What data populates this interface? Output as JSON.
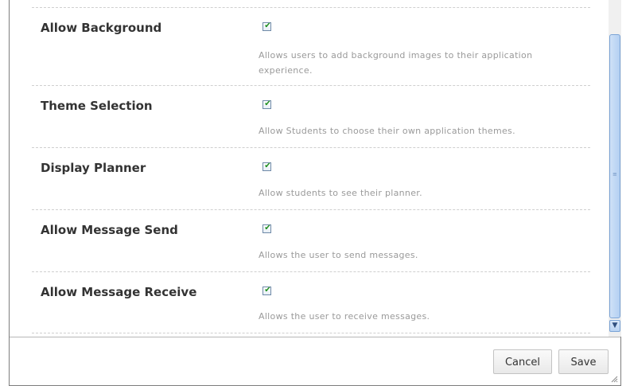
{
  "settings": [
    {
      "label": "Allow Background",
      "checked": true,
      "description": "Allows users to add background images to their application experience."
    },
    {
      "label": "Theme Selection",
      "checked": true,
      "description": "Allow Students to choose their own application themes."
    },
    {
      "label": "Display Planner",
      "checked": true,
      "description": "Allow students to see their planner."
    },
    {
      "label": "Allow Message Send",
      "checked": true,
      "description": "Allows the user to send messages."
    },
    {
      "label": "Allow Message Receive",
      "checked": true,
      "description": "Allows the user to receive messages."
    }
  ],
  "footer": {
    "cancel_label": "Cancel",
    "save_label": "Save"
  },
  "icons": {
    "checkbox_checked": "checkmark-icon",
    "scroll_down": "chevron-down-icon",
    "resize": "resize-grip-icon"
  },
  "colors": {
    "check_mark": "#1f8f1f",
    "scrollbar_thumb": "#b4d0f2",
    "label_text": "#333333",
    "description_text": "#9a9a9a"
  }
}
